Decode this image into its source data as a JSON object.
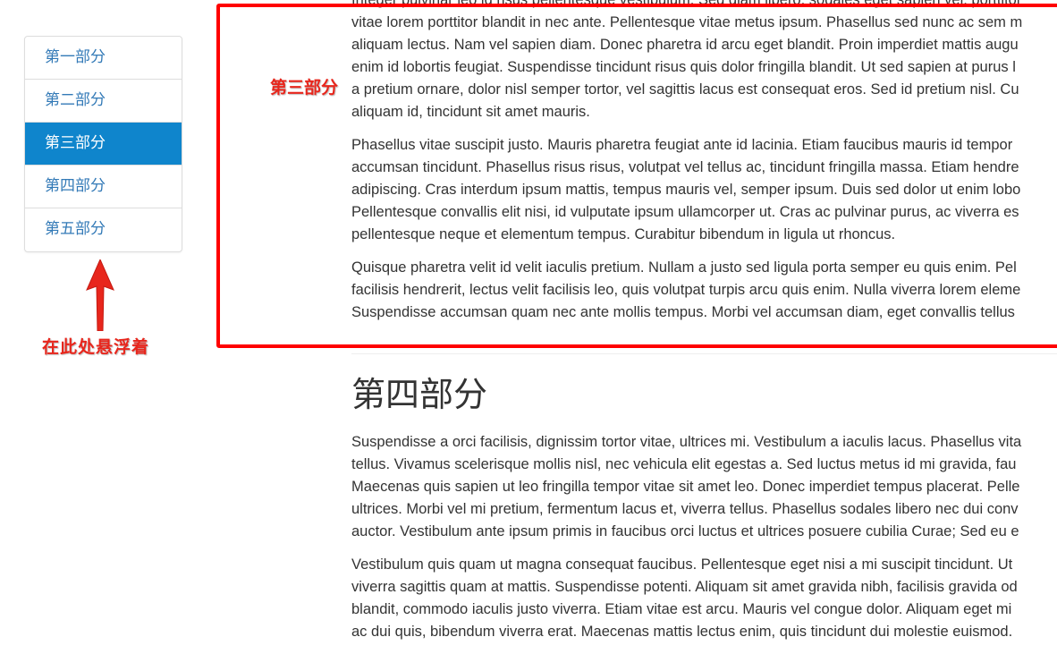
{
  "sidenav": {
    "items": [
      {
        "label": "第一部分",
        "active": false
      },
      {
        "label": "第二部分",
        "active": false
      },
      {
        "label": "第三部分",
        "active": true
      },
      {
        "label": "第四部分",
        "active": false
      },
      {
        "label": "第五部分",
        "active": false
      }
    ]
  },
  "annotations": {
    "hover_note": "在此处悬浮着",
    "section_label": "第三部分",
    "highlight_color": "#ff0000"
  },
  "colors": {
    "active_bg": "#0f85cc",
    "link": "#337ab7",
    "annotation": "#e8261c"
  },
  "section3": {
    "paragraphs": [
      [
        "Integer pulvinar leo id risus pellentesque vestibulum. Sed diam libero, sodales eget sapien vel, porttitor",
        "vitae lorem porttitor blandit in nec ante. Pellentesque vitae metus ipsum. Phasellus sed nunc ac sem m",
        "aliquam lectus. Nam vel sapien diam. Donec pharetra id arcu eget blandit. Proin imperdiet mattis augu",
        "enim id lobortis feugiat. Suspendisse tincidunt risus quis dolor fringilla blandit. Ut sed sapien at purus l",
        "a pretium ornare, dolor nisl semper tortor, vel sagittis lacus est consequat eros. Sed id pretium nisl. Cu",
        "aliquam id, tincidunt sit amet mauris."
      ],
      [
        "Phasellus vitae suscipit justo. Mauris pharetra feugiat ante id lacinia. Etiam faucibus mauris id tempor",
        "accumsan tincidunt. Phasellus risus risus, volutpat vel tellus ac, tincidunt fringilla massa. Etiam hendre",
        "adipiscing. Cras interdum ipsum mattis, tempus mauris vel, semper ipsum. Duis sed dolor ut enim lobo",
        "Pellentesque convallis elit nisi, id vulputate ipsum ullamcorper ut. Cras ac pulvinar purus, ac viverra es",
        "pellentesque neque et elementum tempus. Curabitur bibendum in ligula ut rhoncus."
      ],
      [
        "Quisque pharetra velit id velit iaculis pretium. Nullam a justo sed ligula porta semper eu quis enim. Pel",
        "facilisis hendrerit, lectus velit facilisis leo, quis volutpat turpis arcu quis enim. Nulla viverra lorem eleme",
        "Suspendisse accumsan quam nec ante mollis tempus. Morbi vel accumsan diam, eget convallis tellus"
      ]
    ]
  },
  "section4": {
    "heading": "第四部分",
    "paragraphs": [
      [
        "Suspendisse a orci facilisis, dignissim tortor vitae, ultrices mi. Vestibulum a iaculis lacus. Phasellus vita",
        "tellus. Vivamus scelerisque mollis nisl, nec vehicula elit egestas a. Sed luctus metus id mi gravida, fau",
        "Maecenas quis sapien ut leo fringilla tempor vitae sit amet leo. Donec imperdiet tempus placerat. Pelle",
        "ultrices. Morbi vel mi pretium, fermentum lacus et, viverra tellus. Phasellus sodales libero nec dui conv",
        "auctor. Vestibulum ante ipsum primis in faucibus orci luctus et ultrices posuere cubilia Curae; Sed eu e"
      ],
      [
        "Vestibulum quis quam ut magna consequat faucibus. Pellentesque eget nisi a mi suscipit tincidunt. Ut",
        "viverra sagittis quam at mattis. Suspendisse potenti. Aliquam sit amet gravida nibh, facilisis gravida od",
        "blandit, commodo iaculis justo viverra. Etiam vitae est arcu. Mauris vel congue dolor. Aliquam eget mi",
        "ac dui quis, bibendum viverra erat. Maecenas mattis lectus enim, quis tincidunt dui molestie euismod."
      ]
    ]
  }
}
